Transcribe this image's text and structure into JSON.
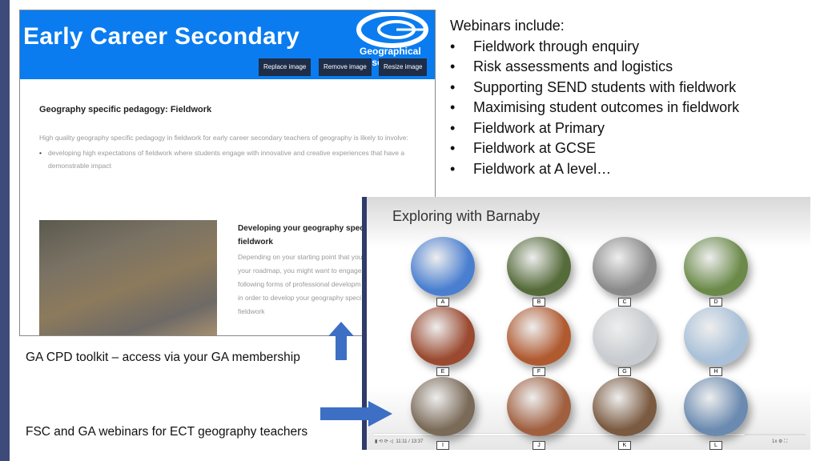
{
  "colors": {
    "accent": "#0a7cf0",
    "arrow": "#3d6fc4",
    "stripe": "#3d4a7a"
  },
  "toolkit": {
    "banner_title": "Early Career Secondary",
    "logo_text": "Geographical Association",
    "buttons": [
      "Replace image",
      "Remove image",
      "Resize image"
    ],
    "heading": "Geography specific pedagogy: Fieldwork",
    "intro": "High quality geography specific pedagogy in fieldwork for early career secondary teachers of geography is likely to involve:",
    "bullet": "developing high expectations of fieldwork where students engage with innovative and creative experiences that have a demonstrable impact",
    "sub_heading": "Developing your geography specific pedagogy in fieldwork",
    "sub_text": [
      "Depending on your starting point that you",
      "your roadmap, you might want to engage",
      "following forms of professional developm",
      "in order to develop your geography speci",
      "fieldwork"
    ]
  },
  "webinars": {
    "title": "Webinars include:",
    "items": [
      "Fieldwork through enquiry",
      "Risk assessments and logistics",
      "Supporting SEND students with fieldwork",
      "Maximising student outcomes in fieldwork",
      "Fieldwork at Primary",
      "Fieldwork at GCSE",
      "Fieldwork at A level…"
    ]
  },
  "video": {
    "title": "Exploring with Barnaby",
    "labels": [
      "A",
      "B",
      "C",
      "D",
      "E",
      "F",
      "G",
      "H",
      "I",
      "J",
      "K",
      "L"
    ],
    "time": "11:11 / 13:37",
    "speed": "1x",
    "progress": 0.86
  },
  "captions": {
    "toolkit": "GA CPD toolkit – access via your GA membership",
    "webinars": "FSC and GA webinars for ECT geography teachers"
  }
}
